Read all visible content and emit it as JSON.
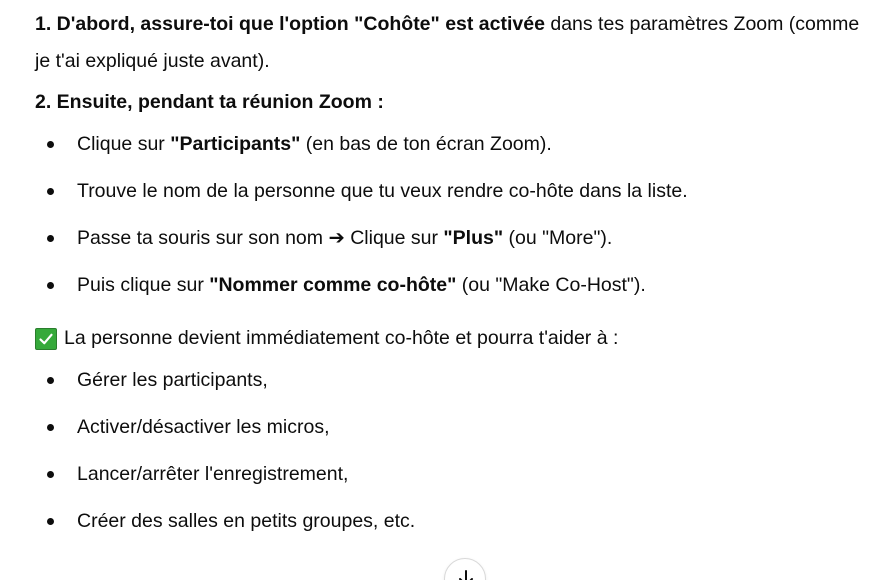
{
  "step1": {
    "bold": "1. D'abord, assure-toi que l'option \"Cohôte\" est activée",
    "rest": " dans tes paramètres Zoom (comme je t'ai expliqué juste avant)."
  },
  "step2": {
    "heading": "2. Ensuite, pendant ta réunion Zoom :",
    "items": [
      {
        "pre": "Clique sur ",
        "bold": "\"Participants\"",
        "post": " (en bas de ton écran Zoom)."
      },
      {
        "pre": "Trouve le nom de la personne que tu veux rendre co-hôte dans la liste.",
        "bold": "",
        "post": ""
      },
      {
        "pre": "Passe ta souris sur son nom ➔ Clique sur ",
        "bold": "\"Plus\"",
        "post": " (ou \"More\")."
      },
      {
        "pre": "Puis clique sur ",
        "bold": "\"Nommer comme co-hôte\"",
        "post": " (ou \"Make Co-Host\")."
      }
    ]
  },
  "result": {
    "text": "La personne devient immédiatement co-hôte et pourra t'aider à :",
    "icon": "check-mark-icon",
    "icon_color": "#35a93a",
    "items": [
      "Gérer les participants,",
      "Activer/désactiver les micros,",
      "Lancer/arrêter l'enregistrement,",
      "Créer des salles en petits groupes, etc."
    ]
  },
  "scroll_button": {
    "icon": "arrow-down-icon"
  }
}
